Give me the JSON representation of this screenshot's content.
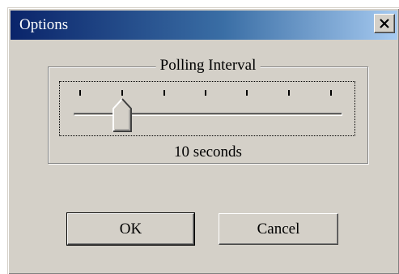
{
  "window": {
    "title": "Options",
    "close_icon": "close-icon"
  },
  "group": {
    "label": "Polling Interval"
  },
  "slider": {
    "value_text": "10 seconds",
    "tick_count": 7,
    "position_index": 1
  },
  "buttons": {
    "ok_label": "OK",
    "cancel_label": "Cancel"
  },
  "colors": {
    "titlebar_start": "#0a246a",
    "titlebar_end": "#a6caf0",
    "face": "#d4d0c8"
  }
}
